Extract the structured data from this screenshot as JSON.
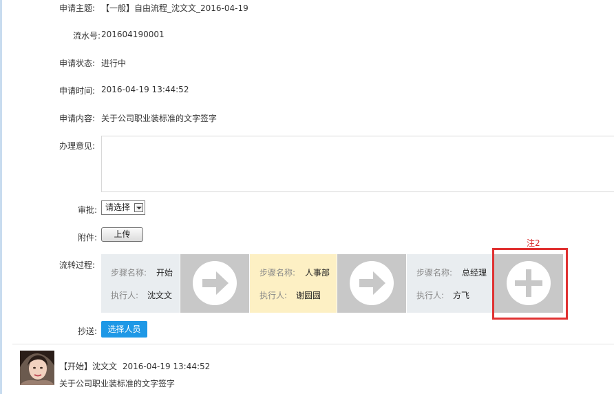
{
  "form": {
    "subject_label": "申请主题:",
    "subject_value": "【一般】自由流程_沈文文_2016-04-19",
    "serial_label": "流水号:",
    "serial_value": "201604190001",
    "status_label": "申请状态:",
    "status_value": "进行中",
    "time_label": "申请时间:",
    "time_value": "2016-04-19 13:44:52",
    "content_label": "申请内容:",
    "content_value": "关于公司职业装标准的文字签字",
    "opinion_label": "办理意见:",
    "opinion_value": "",
    "approve_label": "审批:",
    "approve_selected": "请选择",
    "attachment_label": "附件:",
    "upload_label": "上传",
    "flow_label": "流转过程:",
    "cc_label": "抄送:",
    "select_people_label": "选择人员"
  },
  "flow_steps": [
    {
      "name_label": "步骤名称:",
      "name": "开始",
      "executor_label": "执行人:",
      "executor": "沈文文"
    },
    {
      "name_label": "步骤名称:",
      "name": "人事部",
      "executor_label": "执行人:",
      "executor": "谢圆圆"
    },
    {
      "name_label": "步骤名称:",
      "name": "总经理",
      "executor_label": "执行人:",
      "executor": "方飞"
    }
  ],
  "annotation": {
    "label": "注2",
    "color": "#d9292a"
  },
  "history": [
    {
      "step": "【开始】",
      "user": "沈文文",
      "time": "2016-04-19 13:44:52",
      "content": "关于公司职业装标准的文字签字"
    }
  ],
  "colors": {
    "button_blue": "#1e98e6",
    "step_gray": "#e9edf0",
    "step_yellow": "#fdf0c4",
    "tile_gray": "#c8c8c8",
    "highlight_red": "#e03131"
  },
  "icons": {
    "arrow": "arrow-right-icon",
    "add": "plus-icon"
  }
}
